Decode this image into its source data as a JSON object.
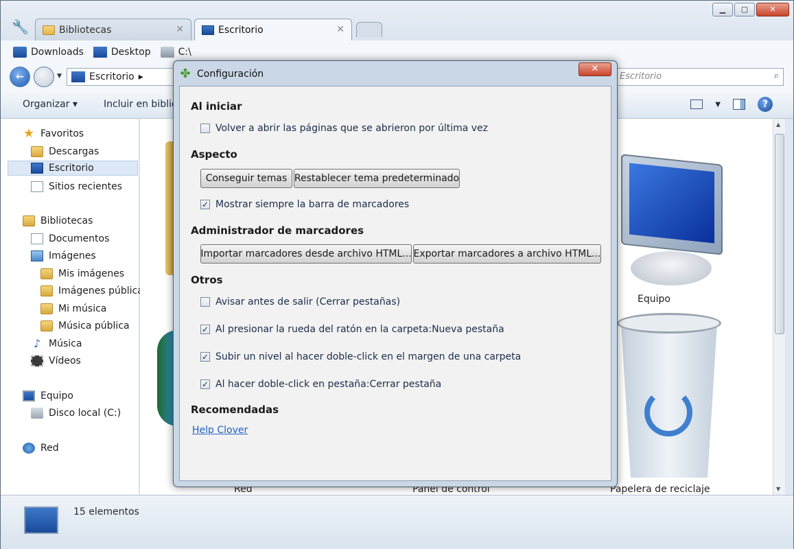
{
  "explorer": {
    "tabs": [
      {
        "label": "Bibliotecas"
      },
      {
        "label": "Escritorio"
      }
    ],
    "favorites_bar": [
      "Downloads",
      "Desktop",
      "C:\\"
    ],
    "address": {
      "location": "Escritorio",
      "separator": "▸"
    },
    "search": {
      "placeholder": "Escritorio"
    },
    "commands": {
      "organize": "Organizar",
      "include": "Incluir en bibliot"
    },
    "nav_pane": {
      "favorites": {
        "label": "Favoritos",
        "items": [
          "Descargas",
          "Escritorio",
          "Sitios recientes"
        ]
      },
      "libraries": {
        "label": "Bibliotecas",
        "items": [
          "Documentos",
          "Imágenes",
          "Mis imágenes",
          "Imágenes públicas",
          "Mi música",
          "Música pública",
          "Música",
          "Vídeos"
        ]
      },
      "computer": {
        "label": "Equipo",
        "items": [
          "Disco local (C:)"
        ]
      },
      "network": {
        "label": "Red"
      }
    },
    "content": {
      "icons": [
        "Equipo",
        "Red",
        "Panel de control",
        "Papelera de reciclaje"
      ]
    },
    "status": {
      "count": "15 elementos"
    }
  },
  "dialog": {
    "title": "Configuración",
    "close": "✕",
    "sections": {
      "startup": {
        "heading": "Al iniciar",
        "reopen": {
          "label": "Volver a abrir las páginas que se abrieron por última vez",
          "checked": false
        }
      },
      "appearance": {
        "heading": "Aspecto",
        "get_themes": "Conseguir temas",
        "reset_theme": "Restablecer tema predeterminado",
        "show_bookmarks": {
          "label": "Mostrar siempre la barra de marcadores",
          "checked": true
        }
      },
      "bookmarks": {
        "heading": "Administrador de marcadores",
        "import": "Importar marcadores desde archivo HTML...",
        "export": "Exportar marcadores a archivo HTML..."
      },
      "others": {
        "heading": "Otros",
        "warn_exit": {
          "label": "Avisar antes de salir (Cerrar pestañas)",
          "checked": false
        },
        "middle_click": {
          "label": "Al presionar la rueda del ratón en la carpeta:Nueva pestaña",
          "checked": true
        },
        "up_level": {
          "label": "Subir un nivel al hacer doble-click en el margen de una carpeta",
          "checked": true
        },
        "tab_dblclick": {
          "label": "Al hacer doble-click en pestaña:Cerrar pestaña",
          "checked": true
        }
      },
      "recommended": {
        "heading": "Recomendadas",
        "help_link": "Help Clover"
      }
    }
  }
}
